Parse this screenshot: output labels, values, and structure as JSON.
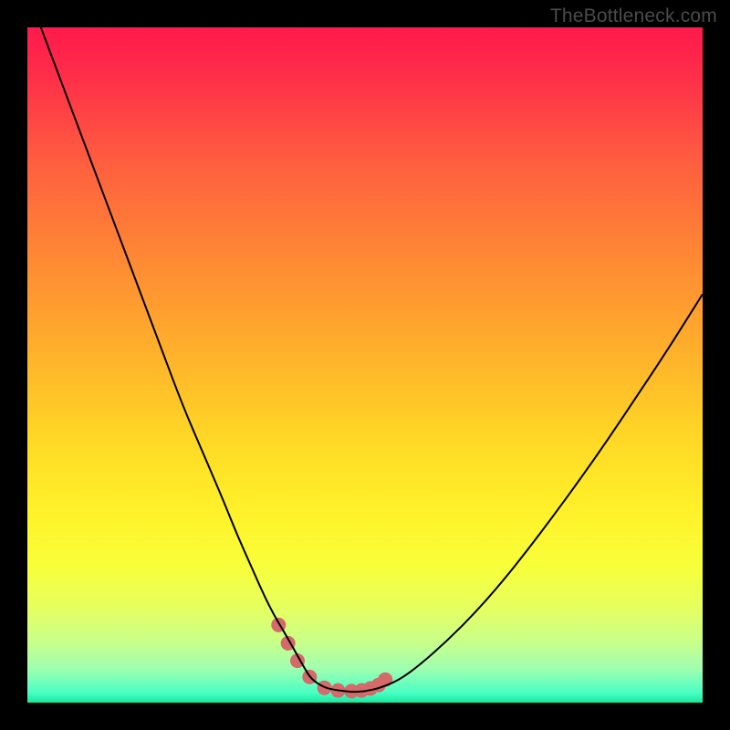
{
  "watermark": "TheBottleneck.com",
  "chart_data": {
    "type": "line",
    "title": "",
    "xlabel": "",
    "ylabel": "",
    "xlim": [
      0,
      100
    ],
    "ylim": [
      0,
      100
    ],
    "background_gradient_stops": [
      {
        "offset": 0.0,
        "color": "#ff1a4b"
      },
      {
        "offset": 0.06,
        "color": "#ff2a4a"
      },
      {
        "offset": 0.2,
        "color": "#ff5e3f"
      },
      {
        "offset": 0.35,
        "color": "#ff8b33"
      },
      {
        "offset": 0.5,
        "color": "#ffb62a"
      },
      {
        "offset": 0.62,
        "color": "#ffdb25"
      },
      {
        "offset": 0.72,
        "color": "#fff22a"
      },
      {
        "offset": 0.8,
        "color": "#f7ff3a"
      },
      {
        "offset": 0.86,
        "color": "#e6ff60"
      },
      {
        "offset": 0.91,
        "color": "#c8ff8a"
      },
      {
        "offset": 0.95,
        "color": "#9effb0"
      },
      {
        "offset": 0.985,
        "color": "#4affc4"
      },
      {
        "offset": 1.0,
        "color": "#17e99e"
      }
    ],
    "series": [
      {
        "name": "bottleneck-curve",
        "color": "#000000",
        "stroke_width": 2,
        "x": [
          2,
          5,
          8,
          11,
          14,
          17,
          20,
          23,
          26,
          29,
          31,
          33,
          35,
          36.5,
          38,
          39.2,
          40.2,
          41,
          42,
          44,
          46,
          48,
          49,
          50,
          52,
          55,
          58,
          62,
          66,
          70,
          74,
          78,
          82,
          86,
          90,
          94,
          98,
          100
        ],
        "y": [
          100,
          92,
          84,
          76,
          68,
          60,
          52,
          44,
          37,
          30,
          25,
          20.5,
          16,
          13,
          10.5,
          8.4,
          6.6,
          5.2,
          3.5,
          2.2,
          1.8,
          1.6,
          1.6,
          1.7,
          2.1,
          3.3,
          5.5,
          9,
          13,
          17.5,
          22.5,
          27.8,
          33.3,
          39,
          45,
          51,
          57.3,
          60.5
        ]
      }
    ],
    "markers": {
      "name": "highlight-dots",
      "color": "#d46a6a",
      "radius": 8,
      "x": [
        37.2,
        38.6,
        40.0,
        41.8,
        44.0,
        46.0,
        48.0,
        49.5,
        50.8,
        52.0,
        53.0
      ],
      "y": [
        11.5,
        8.8,
        6.2,
        3.8,
        2.2,
        1.8,
        1.7,
        1.8,
        2.1,
        2.6,
        3.4
      ]
    }
  }
}
